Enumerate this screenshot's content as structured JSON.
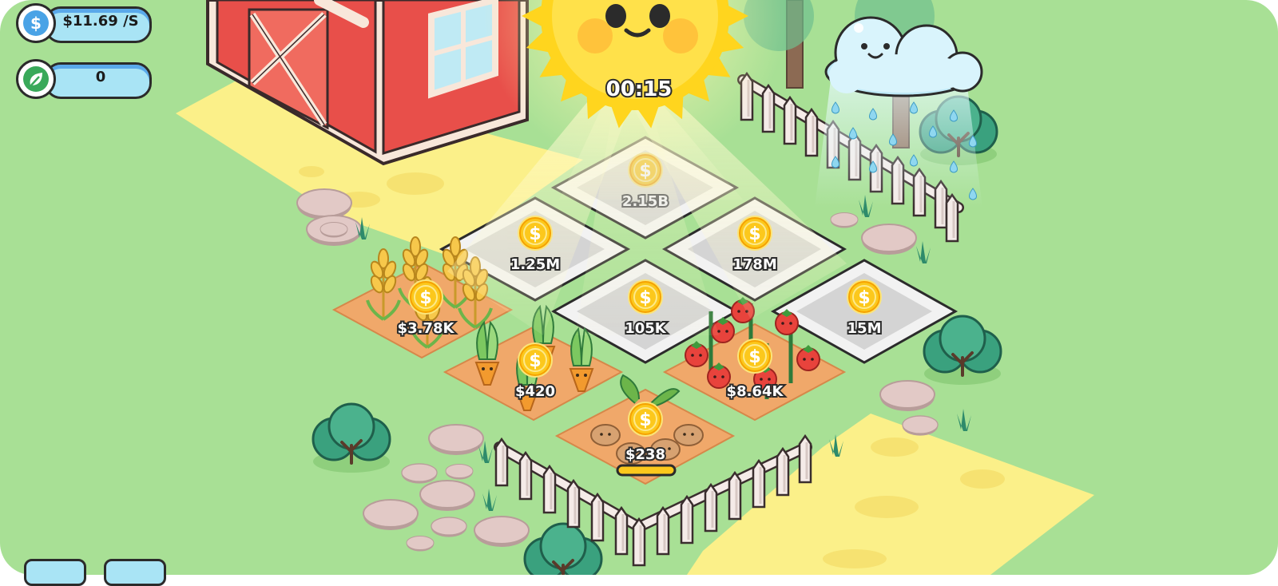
{
  "hud": {
    "money_per_sec": "$11.69 /S",
    "money_icon": "dollar-icon",
    "leaves": "0",
    "leaf_icon": "leaf-icon"
  },
  "sun": {
    "timer": "00:15"
  },
  "plots": {
    "locked": [
      {
        "name": "locked-plot-top",
        "price": "2.15B"
      },
      {
        "name": "locked-plot-left",
        "price": "1.25M"
      },
      {
        "name": "locked-plot-right",
        "price": "178M"
      },
      {
        "name": "locked-plot-center",
        "price": "105K"
      },
      {
        "name": "locked-plot-far-right",
        "price": "15M"
      }
    ],
    "crops": [
      {
        "name": "wheat-plot",
        "crop": "wheat",
        "earning": "$3.78K"
      },
      {
        "name": "carrot-plot",
        "crop": "carrot",
        "earning": "$420"
      },
      {
        "name": "tomato-plot",
        "crop": "tomato",
        "earning": "$8.64K"
      },
      {
        "name": "potato-plot",
        "crop": "potato",
        "earning": "$238",
        "progress": 0.0
      }
    ]
  },
  "colors": {
    "grass": "#a8e095",
    "path": "#fbf089",
    "soil": "#f0a86a",
    "coin": "#fcc81c",
    "locked_tile": "#d4d4d4",
    "sun": "#ffd51e",
    "barn": "#e84f4a"
  }
}
